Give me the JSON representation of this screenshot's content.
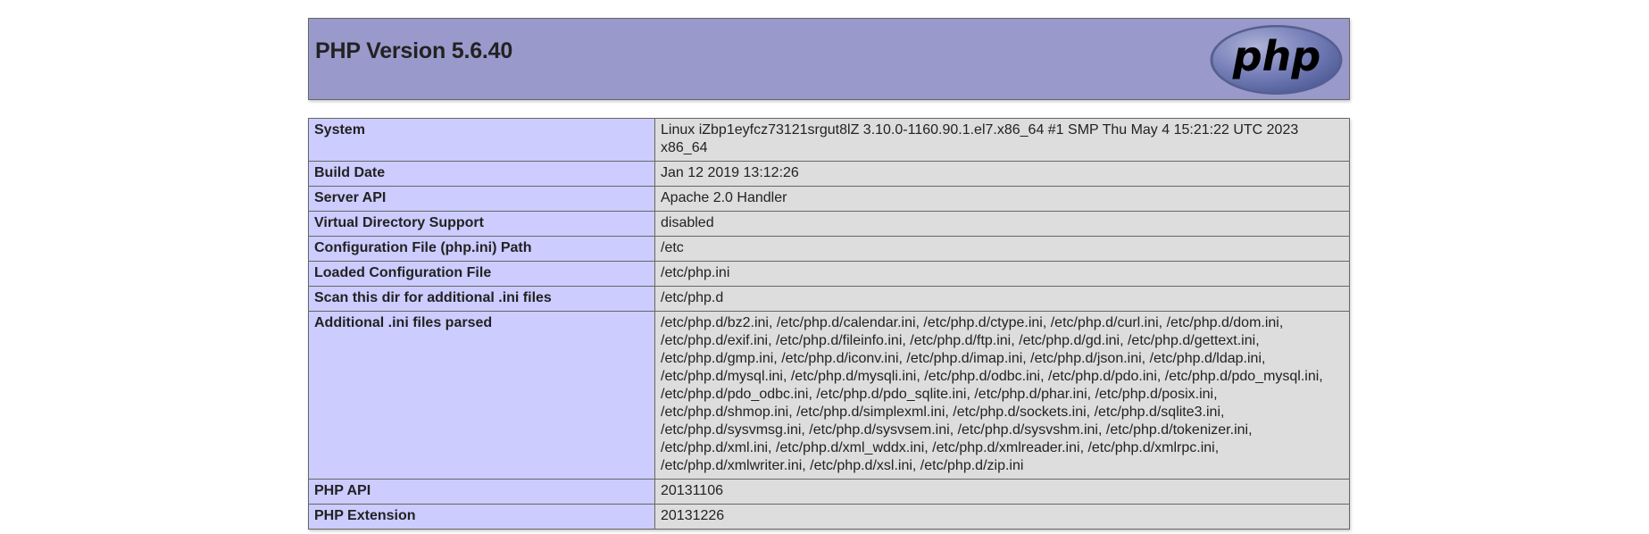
{
  "header": {
    "title": "PHP Version 5.6.40",
    "logo_text": "php",
    "logo_label": "php-logo"
  },
  "info": {
    "rows": [
      {
        "name": "System",
        "value": "Linux iZbp1eyfcz73121srgut8lZ 3.10.0-1160.90.1.el7.x86_64 #1 SMP Thu May 4 15:21:22 UTC 2023 x86_64"
      },
      {
        "name": "Build Date",
        "value": "Jan 12 2019 13:12:26"
      },
      {
        "name": "Server API",
        "value": "Apache 2.0 Handler"
      },
      {
        "name": "Virtual Directory Support",
        "value": "disabled"
      },
      {
        "name": "Configuration File (php.ini) Path",
        "value": "/etc"
      },
      {
        "name": "Loaded Configuration File",
        "value": "/etc/php.ini"
      },
      {
        "name": "Scan this dir for additional .ini files",
        "value": "/etc/php.d"
      },
      {
        "name": "Additional .ini files parsed",
        "value": "/etc/php.d/bz2.ini, /etc/php.d/calendar.ini, /etc/php.d/ctype.ini, /etc/php.d/curl.ini, /etc/php.d/dom.ini, /etc/php.d/exif.ini, /etc/php.d/fileinfo.ini, /etc/php.d/ftp.ini, /etc/php.d/gd.ini, /etc/php.d/gettext.ini, /etc/php.d/gmp.ini, /etc/php.d/iconv.ini, /etc/php.d/imap.ini, /etc/php.d/json.ini, /etc/php.d/ldap.ini, /etc/php.d/mysql.ini, /etc/php.d/mysqli.ini, /etc/php.d/odbc.ini, /etc/php.d/pdo.ini, /etc/php.d/pdo_mysql.ini, /etc/php.d/pdo_odbc.ini, /etc/php.d/pdo_sqlite.ini, /etc/php.d/phar.ini, /etc/php.d/posix.ini, /etc/php.d/shmop.ini, /etc/php.d/simplexml.ini, /etc/php.d/sockets.ini, /etc/php.d/sqlite3.ini, /etc/php.d/sysvmsg.ini, /etc/php.d/sysvsem.ini, /etc/php.d/sysvshm.ini, /etc/php.d/tokenizer.ini, /etc/php.d/xml.ini, /etc/php.d/xml_wddx.ini, /etc/php.d/xmlreader.ini, /etc/php.d/xmlrpc.ini, /etc/php.d/xmlwriter.ini, /etc/php.d/xsl.ini, /etc/php.d/zip.ini"
      },
      {
        "name": "PHP API",
        "value": "20131106"
      },
      {
        "name": "PHP Extension",
        "value": "20131226"
      }
    ]
  },
  "colors": {
    "header_bg": "#9999cc",
    "label_bg": "#ccccff",
    "value_bg": "#dddddd",
    "border": "#666666",
    "logo_bg": "#6c78b0",
    "logo_text": "#000000"
  }
}
